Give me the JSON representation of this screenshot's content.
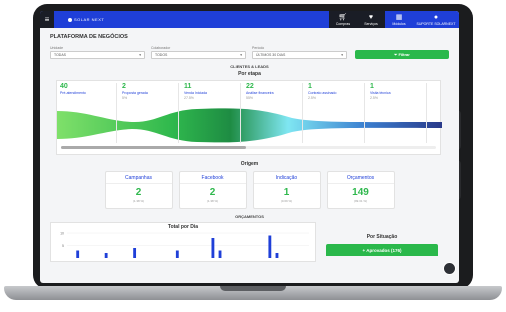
{
  "header": {
    "logo_text": "SOLAR NEXT",
    "nav": [
      {
        "label": "Compras",
        "icon": "cart-icon"
      },
      {
        "label": "Serviços",
        "icon": "heart-icon"
      },
      {
        "label": "Módulos",
        "icon": "grid-icon"
      }
    ],
    "user_label": "SUPORTE SOLARNEXT"
  },
  "page": {
    "title": "PLATAFORMA DE NEGÓCIOS"
  },
  "filters": [
    {
      "label": "Unidade",
      "value": "TODAS"
    },
    {
      "label": "Colaborador",
      "value": "TODOS"
    },
    {
      "label": "Período",
      "value": "ÚLTIMOS 30 DIAS"
    }
  ],
  "filter_button": "Filtrar",
  "leads": {
    "section_title": "CLIENTES & LEADS",
    "subtitle": "Por etapa",
    "stages": [
      {
        "count": "40",
        "name": "Pré-atendimento",
        "percent": ""
      },
      {
        "count": "2",
        "name": "Proposta gerada",
        "percent": "5%"
      },
      {
        "count": "11",
        "name": "Venda Iniciada",
        "percent": "27.5%"
      },
      {
        "count": "22",
        "name": "Análise financeira",
        "percent": "55%"
      },
      {
        "count": "1",
        "name": "Contrato assinado",
        "percent": "2.5%"
      },
      {
        "count": "1",
        "name": "Visita técnica",
        "percent": "2.5%"
      }
    ]
  },
  "origem": {
    "title": "Origem",
    "cards": [
      {
        "title": "Campanhas",
        "value": "2",
        "percent": "(1.38 %)"
      },
      {
        "title": "Facebook",
        "value": "2",
        "percent": "(1.38 %)"
      },
      {
        "title": "Indicação",
        "value": "1",
        "percent": "(0.69 %)"
      },
      {
        "title": "Orçamentos",
        "value": "149",
        "percent": "(99.31 %)"
      }
    ]
  },
  "orcamentos": {
    "section_title": "ORÇAMENTOS",
    "per_day_title": "Total por Dia",
    "situation_title": "Por Situação",
    "approved_label": "+ Aprovados (176)"
  },
  "chart_data": {
    "type": "bar",
    "title": "Total por Dia",
    "ylim": [
      0,
      10
    ],
    "yticks": [
      "10",
      "5"
    ],
    "values": [
      0,
      3,
      0,
      0,
      0,
      2,
      0,
      0,
      0,
      4,
      0,
      0,
      0,
      0,
      0,
      3,
      0,
      0,
      0,
      0,
      8,
      3,
      0,
      0,
      0,
      0,
      0,
      0,
      9,
      2,
      0,
      0,
      0,
      0
    ]
  },
  "colors": {
    "primary": "#1f3fd8",
    "success": "#2ab84b",
    "dark": "#1a1d26"
  }
}
